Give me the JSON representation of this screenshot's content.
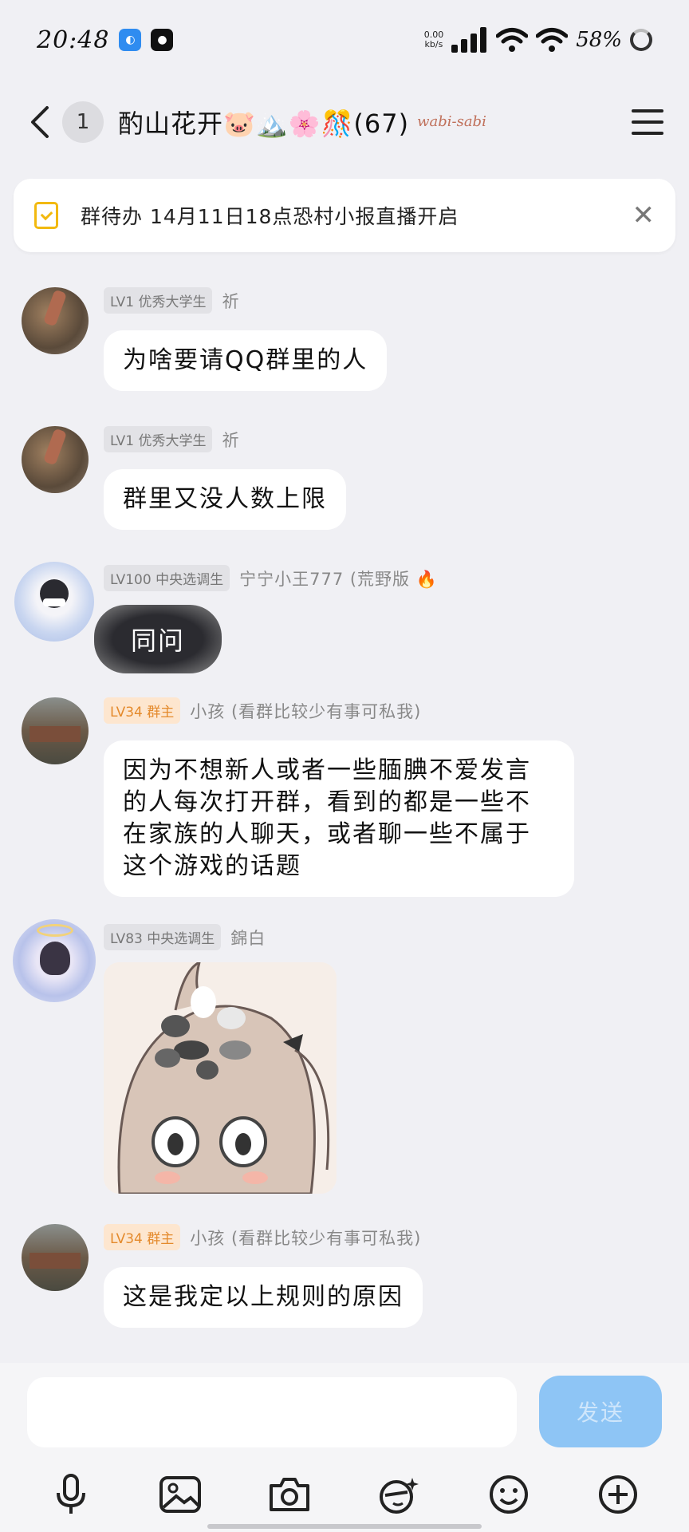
{
  "status_bar": {
    "time": "20:48",
    "net_speed_value": "0.00",
    "net_speed_unit": "kb/s",
    "battery": "58%"
  },
  "header": {
    "unread": "1",
    "title": "酌山花开🐷🏔️🌸🎊(67)",
    "title_tag": "wabi-sabi"
  },
  "todo": {
    "text": "群待办 14月11日18点恐村小报直播开启"
  },
  "messages": [
    {
      "level": "LV1 优秀大学生",
      "sender": "祈",
      "text": "为啥要请QQ群里的人"
    },
    {
      "level": "LV1 优秀大学生",
      "sender": "祈",
      "text": "群里又没人数上限"
    },
    {
      "level": "LV100 中央选调生",
      "sender": "宁宁小王777 (荒野版 🔥",
      "sticker_text": "同问"
    },
    {
      "level": "LV34 群主",
      "sender": "小孩 (看群比较少有事可私我)",
      "text": "因为不想新人或者一些腼腆不爱发言的人每次打开群，看到的都是一些不在家族的人聊天，或者聊一些不属于这个游戏的话题"
    },
    {
      "level": "LV83 中央选调生",
      "sender": "錦白"
    },
    {
      "level": "LV34 群主",
      "sender": "小孩 (看群比较少有事可私我)",
      "text": "这是我定以上规则的原因"
    }
  ],
  "input": {
    "placeholder": "",
    "send_label": "发送"
  },
  "colors": {
    "accent": "#8ec5f5",
    "owner_badge": "#e48a2c",
    "todo_icon": "#f2b90f"
  }
}
